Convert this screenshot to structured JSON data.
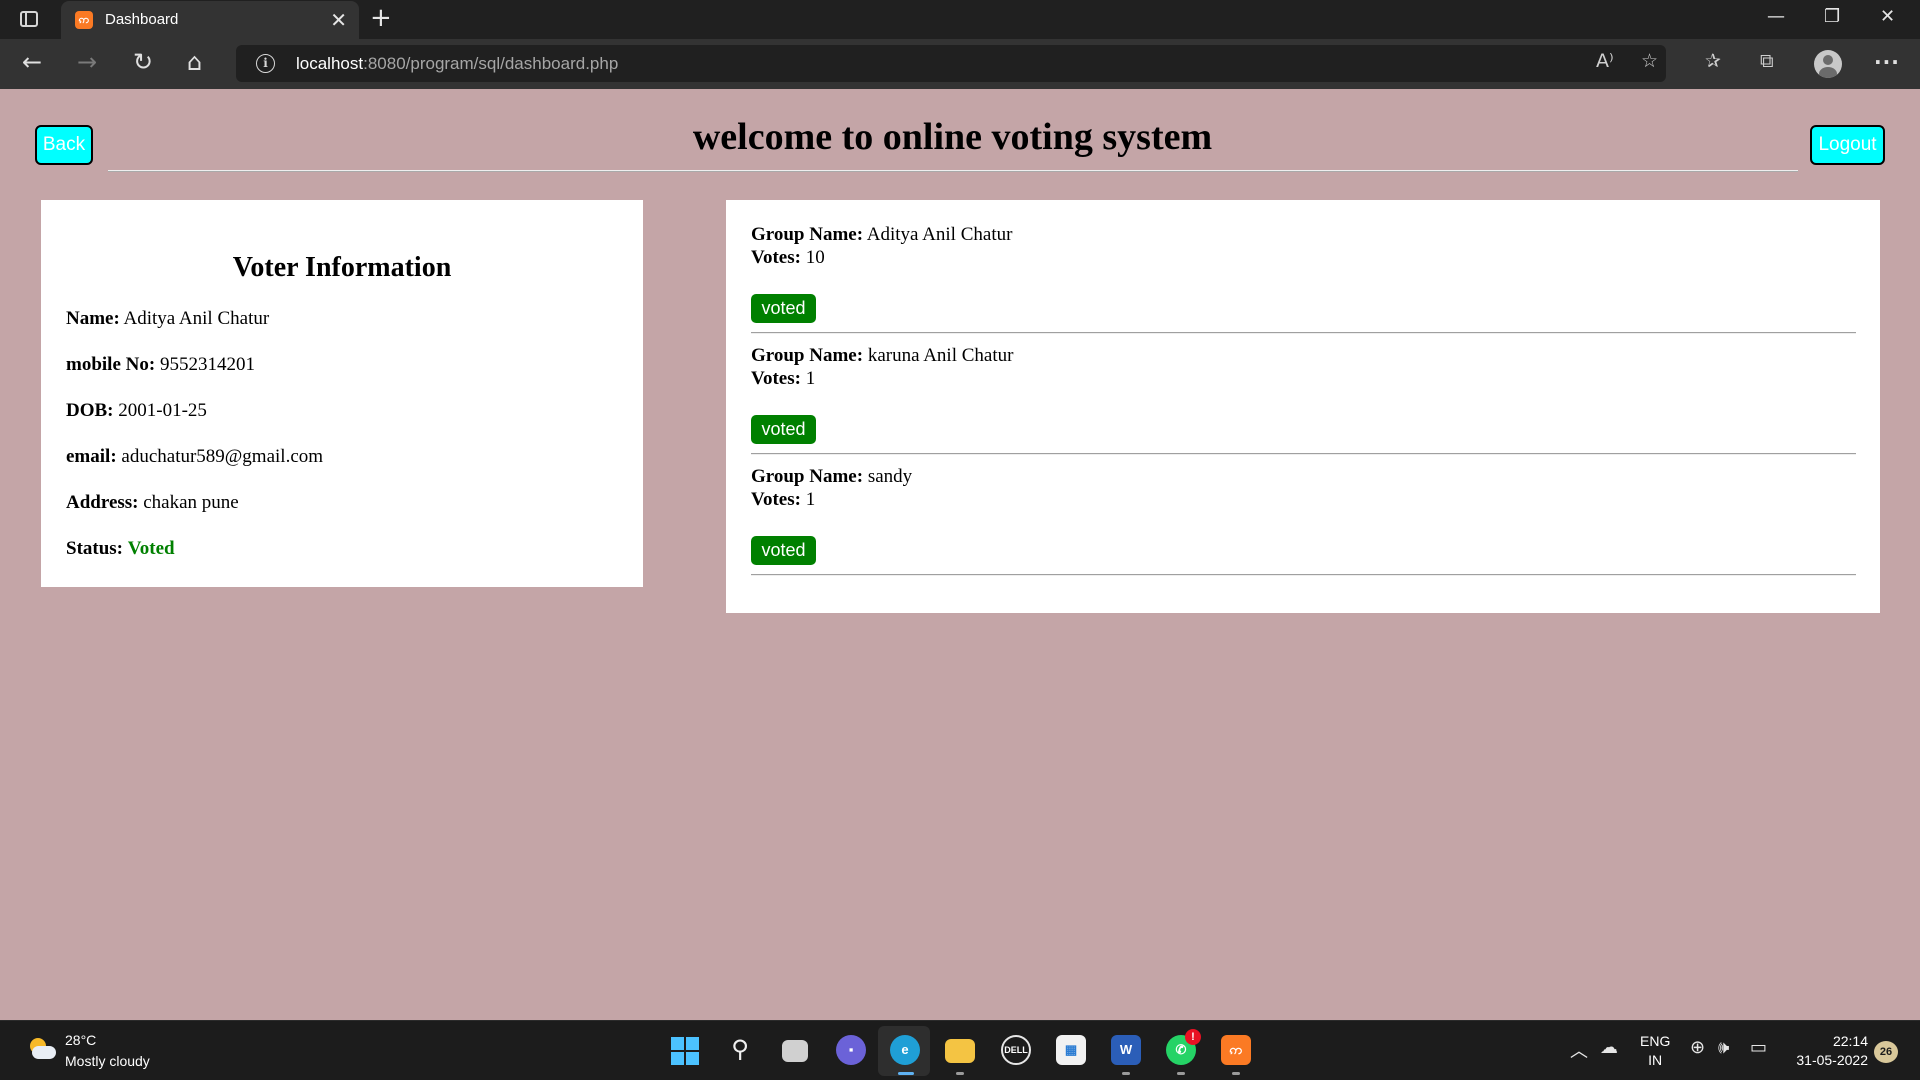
{
  "browser": {
    "tab_title": "Dashboard",
    "url_host": "localhost",
    "url_path": ":8080/program/sql/dashboard.php"
  },
  "header": {
    "back_label": "Back",
    "title": "welcome to online voting system",
    "logout_label": "Logout"
  },
  "voter": {
    "heading": "Voter Information",
    "fields": [
      {
        "label": "Name:",
        "value": "Aditya Anil Chatur"
      },
      {
        "label": "mobile No:",
        "value": "9552314201"
      },
      {
        "label": "DOB:",
        "value": "2001-01-25"
      },
      {
        "label": "email:",
        "value": "aduchatur589@gmail.com"
      },
      {
        "label": "Address:",
        "value": "chakan pune"
      }
    ],
    "status_label": "Status:",
    "status_value": "Voted",
    "status_color": "#008000"
  },
  "groups": {
    "group_label": "Group Name:",
    "votes_label": "Votes:",
    "items": [
      {
        "name": "Aditya Anil Chatur",
        "votes": "10",
        "button": "voted"
      },
      {
        "name": "karuna Anil Chatur",
        "votes": "1",
        "button": "voted"
      },
      {
        "name": "sandy",
        "votes": "1",
        "button": "voted"
      }
    ]
  },
  "taskbar": {
    "weather_temp": "28°C",
    "weather_desc": "Mostly cloudy",
    "lang_line1": "ENG",
    "lang_line2": "IN",
    "time": "22:14",
    "date": "31-05-2022",
    "notification_count": "26",
    "whatsapp_badge": "!"
  },
  "colors": {
    "page_background": "#c4a5a7",
    "button_cyan": "#00ffff",
    "voted_green": "#008000"
  }
}
